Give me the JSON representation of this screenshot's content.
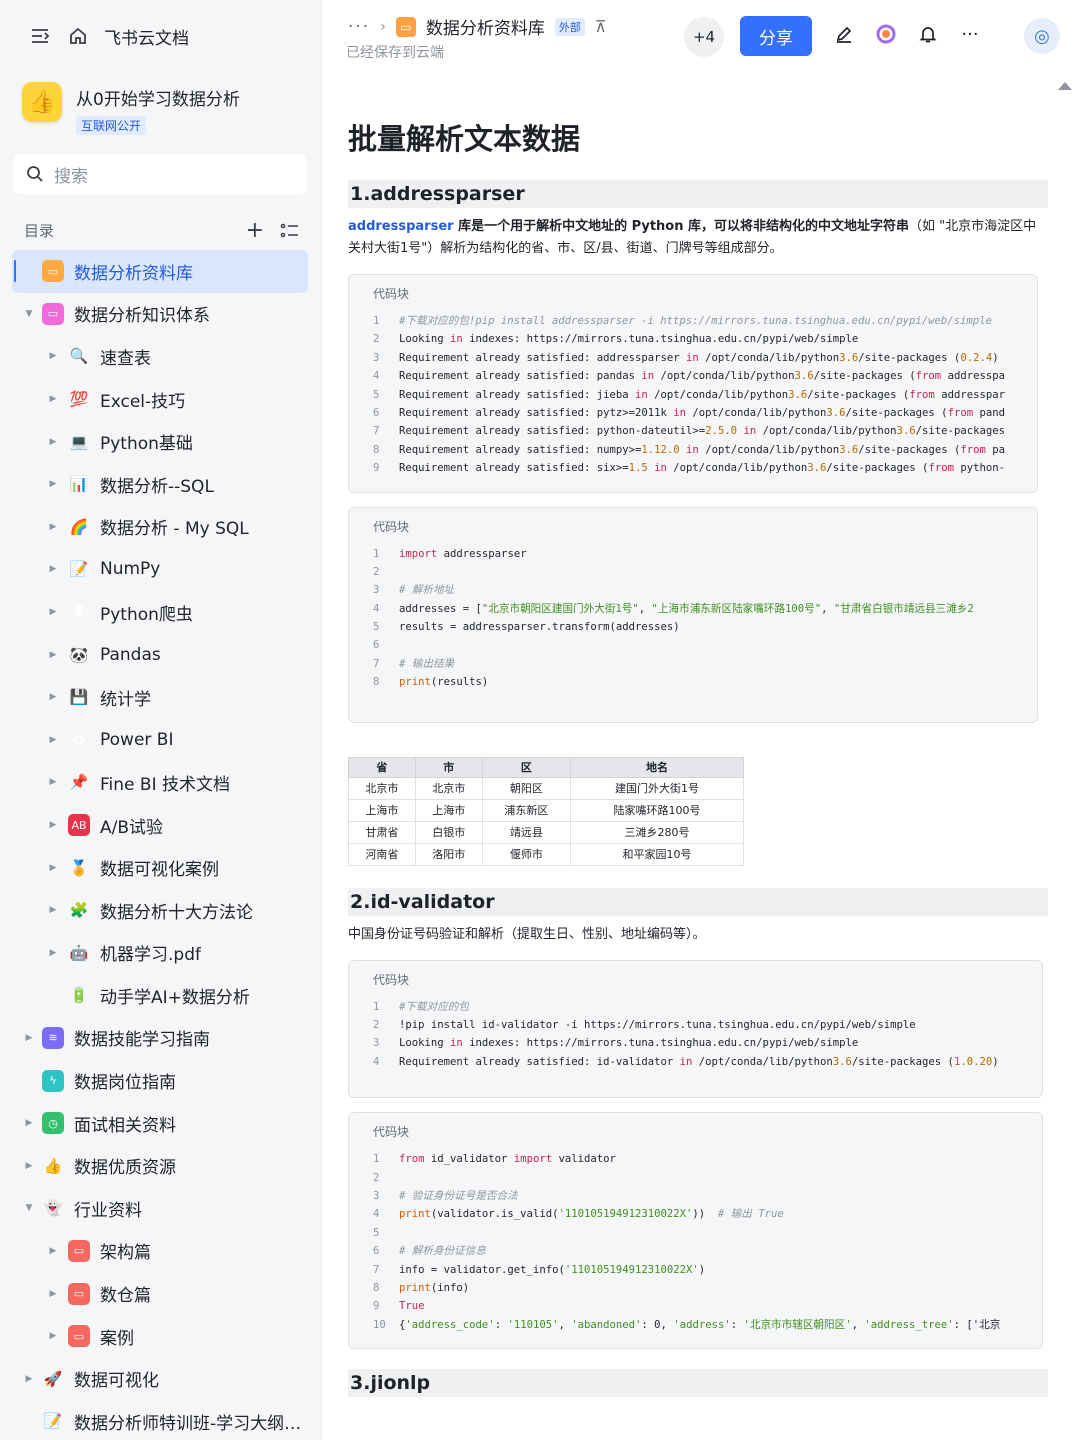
{
  "app": {
    "brand": "飞书云文档"
  },
  "space": {
    "name": "从0开始学习数据分析",
    "tag": "互联网公开"
  },
  "search": {
    "placeholder": "搜索"
  },
  "toc": {
    "label": "目录"
  },
  "tree": [
    {
      "label": "数据分析资料库",
      "level": 0,
      "arrow": "",
      "icon": "folder-orange-icon",
      "active": true
    },
    {
      "label": "数据分析知识体系",
      "level": 0,
      "arrow": "▼",
      "icon": "folder-pink-icon"
    },
    {
      "label": "速查表",
      "level": 1,
      "arrow": "▶",
      "icon": "magnifier-icon"
    },
    {
      "label": "Excel-技巧",
      "level": 1,
      "arrow": "▶",
      "icon": "hundred-icon"
    },
    {
      "label": "Python基础",
      "level": 1,
      "arrow": "▶",
      "icon": "monitor-icon"
    },
    {
      "label": "数据分析--SQL",
      "level": 1,
      "arrow": "▶",
      "icon": "bar-chart-icon"
    },
    {
      "label": "数据分析 - My SQL",
      "level": 1,
      "arrow": "▶",
      "icon": "rainbow-icon"
    },
    {
      "label": "NumPy",
      "level": 1,
      "arrow": "▶",
      "icon": "memo-icon"
    },
    {
      "label": "Python爬虫",
      "level": 1,
      "arrow": "▶",
      "icon": "spider-icon"
    },
    {
      "label": "Pandas",
      "level": 1,
      "arrow": "▶",
      "icon": "panda-icon"
    },
    {
      "label": "统计学",
      "level": 1,
      "arrow": "▶",
      "icon": "floppy-icon"
    },
    {
      "label": "Power BI",
      "level": 1,
      "arrow": "▶",
      "icon": "recycle-icon"
    },
    {
      "label": "Fine BI 技术文档",
      "level": 1,
      "arrow": "▶",
      "icon": "pushpin-icon"
    },
    {
      "label": "A/B试验",
      "level": 1,
      "arrow": "▶",
      "icon": "ab-icon"
    },
    {
      "label": "数据可视化案例",
      "level": 1,
      "arrow": "▶",
      "icon": "medal-icon"
    },
    {
      "label": "数据分析十大方法论",
      "level": 1,
      "arrow": "▶",
      "icon": "puzzle-icon"
    },
    {
      "label": "机器学习.pdf",
      "level": 1,
      "arrow": "▶",
      "icon": "robot-icon"
    },
    {
      "label": "动手学AI+数据分析",
      "level": 1,
      "arrow": "",
      "icon": "battery-icon"
    },
    {
      "label": "数据技能学习指南",
      "level": 0,
      "arrow": "▶",
      "icon": "layers-icon"
    },
    {
      "label": "数据岗位指南",
      "level": 0,
      "arrow": "",
      "icon": "lightning-icon"
    },
    {
      "label": "面试相关资料",
      "level": 0,
      "arrow": "▶",
      "icon": "clock-icon"
    },
    {
      "label": "数据优质资源",
      "level": 0,
      "arrow": "▶",
      "icon": "thumbs-up-icon"
    },
    {
      "label": "行业资料",
      "level": 0,
      "arrow": "▼",
      "icon": "ghost-icon"
    },
    {
      "label": "架构篇",
      "level": 1,
      "arrow": "▶",
      "icon": "folder-red-icon"
    },
    {
      "label": "数仓篇",
      "level": 1,
      "arrow": "▶",
      "icon": "folder-red-icon"
    },
    {
      "label": "案例",
      "level": 1,
      "arrow": "▶",
      "icon": "folder-red-icon"
    },
    {
      "label": "数据可视化",
      "level": 0,
      "arrow": "▶",
      "icon": "rocket-icon"
    },
    {
      "label": "数据分析师特训班-学习大纲（...",
      "level": 0,
      "arrow": "",
      "icon": "memo-icon"
    }
  ],
  "header": {
    "crumb_dots": "···",
    "doc_title": "数据分析资料库",
    "external_tag": "外部",
    "saved": "已经保存到云端",
    "collaborators": "+4",
    "share": "分享"
  },
  "doc": {
    "title": "批量解析文本数据",
    "s1": {
      "heading": "1.addressparser",
      "kw": "addressparser",
      "desc_bold": " 库是一个用于解析中文地址的 Python 库，可以将非结构化的中文地址字符串",
      "desc_rest": "（如 \"北京市海淀区中关村大街1号\"）解析为结构化的省、市、区/县、街道、门牌号等组成部分。",
      "code_label": "代码块",
      "code_label2": "代码块"
    },
    "table": {
      "headers": [
        "省",
        "市",
        "区",
        "地名"
      ],
      "rows": [
        [
          "北京市",
          "北京市",
          "朝阳区",
          "建国门外大街1号"
        ],
        [
          "上海市",
          "上海市",
          "浦东新区",
          "陆家嘴环路100号"
        ],
        [
          "甘肃省",
          "白银市",
          "靖远县",
          "三滩乡280号"
        ],
        [
          "河南省",
          "洛阳市",
          "偃师市",
          "和平家园10号"
        ]
      ]
    },
    "s2": {
      "heading": "2.id-validator",
      "desc": "中国身份证号码验证和解析（提取生日、性别、地址编码等）。",
      "code_label": "代码块",
      "code_label2": "代码块"
    },
    "s3": {
      "heading": "3.jionlp"
    }
  },
  "code_blocks": {
    "b1": [
      "#下载对应的包!pip install addressparser -i https://mirrors.tuna.tsinghua.edu.cn/pypi/web/simple",
      "Looking in indexes: https://mirrors.tuna.tsinghua.edu.cn/pypi/web/simple",
      "Requirement already satisfied: addressparser in /opt/conda/lib/python3.6/site-packages (0.2.4)",
      "Requirement already satisfied: pandas in /opt/conda/lib/python3.6/site-packages (from addresspa",
      "Requirement already satisfied: jieba in /opt/conda/lib/python3.6/site-packages (from addresspar",
      "Requirement already satisfied: pytz>=2011k in /opt/conda/lib/python3.6/site-packages (from pand",
      "Requirement already satisfied: python-dateutil>=2.5.0 in /opt/conda/lib/python3.6/site-packages",
      "Requirement already satisfied: numpy>=1.12.0 in /opt/conda/lib/python3.6/site-packages (from pa",
      "Requirement already satisfied: six>=1.5 in /opt/conda/lib/python3.6/site-packages (from python-"
    ],
    "b2": [
      "import addressparser",
      "",
      "# 解析地址",
      "addresses = [\"北京市朝阳区建国门外大街1号\", \"上海市浦东新区陆家嘴环路100号\", \"甘肃省白银市靖远县三滩乡2",
      "results = addressparser.transform(addresses)",
      "",
      "# 输出结果",
      "print(results)"
    ],
    "b3": [
      "#下载对应的包",
      "!pip install id-validator -i https://mirrors.tuna.tsinghua.edu.cn/pypi/web/simple",
      "Looking in indexes: https://mirrors.tuna.tsinghua.edu.cn/pypi/web/simple",
      "Requirement already satisfied: id-validator in /opt/conda/lib/python3.6/site-packages (1.0.20)"
    ],
    "b4": [
      "from id_validator import validator",
      "",
      "# 验证身份证号是否合法",
      "print(validator.is_valid('110105194912310022X'))  # 输出 True",
      "",
      "# 解析身份证信息",
      "info = validator.get_info('110105194912310022X')",
      "print(info)",
      "True",
      "{'address_code': '110105', 'abandoned': 0, 'address': '北京市市辖区朝阳区', 'address_tree': ['北京"
    ]
  }
}
